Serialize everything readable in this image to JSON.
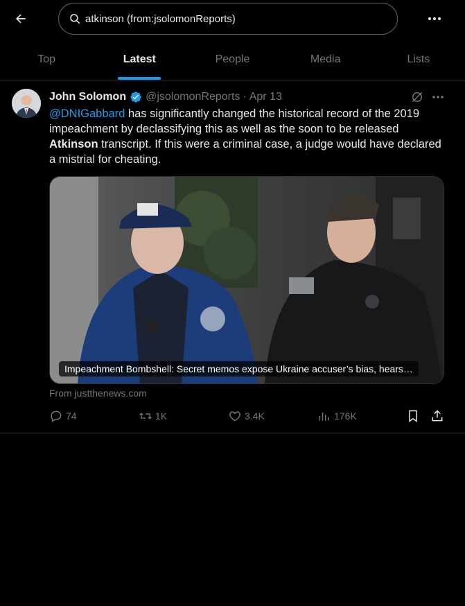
{
  "search": {
    "query": "atkinson (from:jsolomonReports)"
  },
  "tabs": [
    {
      "label": "Top"
    },
    {
      "label": "Latest"
    },
    {
      "label": "People"
    },
    {
      "label": "Media"
    },
    {
      "label": "Lists"
    }
  ],
  "tweet": {
    "name": "John Solomon",
    "handle": "@jsolomonReports",
    "separator": "·",
    "date": "Apr 13",
    "text": {
      "mention": "@DNIGabbard",
      "part1": " has significantly changed the historical record of the 2019 impeachment by declassifying this as well as the soon to be released ",
      "bold": "Atkinson",
      "part2": " transcript. If this were a criminal case, a judge would have declared a mistrial for cheating."
    },
    "card": {
      "caption": "Impeachment Bombshell: Secret memos expose Ukraine accuser’s bias, hears…",
      "source": "From justthenews.com"
    },
    "actions": {
      "replies": "74",
      "reposts": "1K",
      "likes": "3.4K",
      "views": "176K"
    }
  },
  "colors": {
    "accent": "#1d9bf0",
    "background": "#000000",
    "muted": "#71767b",
    "border": "#2f3336"
  },
  "icons": [
    "back-arrow-icon",
    "search-icon",
    "more-icon",
    "verified-badge-icon",
    "grok-icon",
    "reply-icon",
    "repost-icon",
    "like-icon",
    "views-icon",
    "bookmark-icon",
    "share-icon"
  ]
}
